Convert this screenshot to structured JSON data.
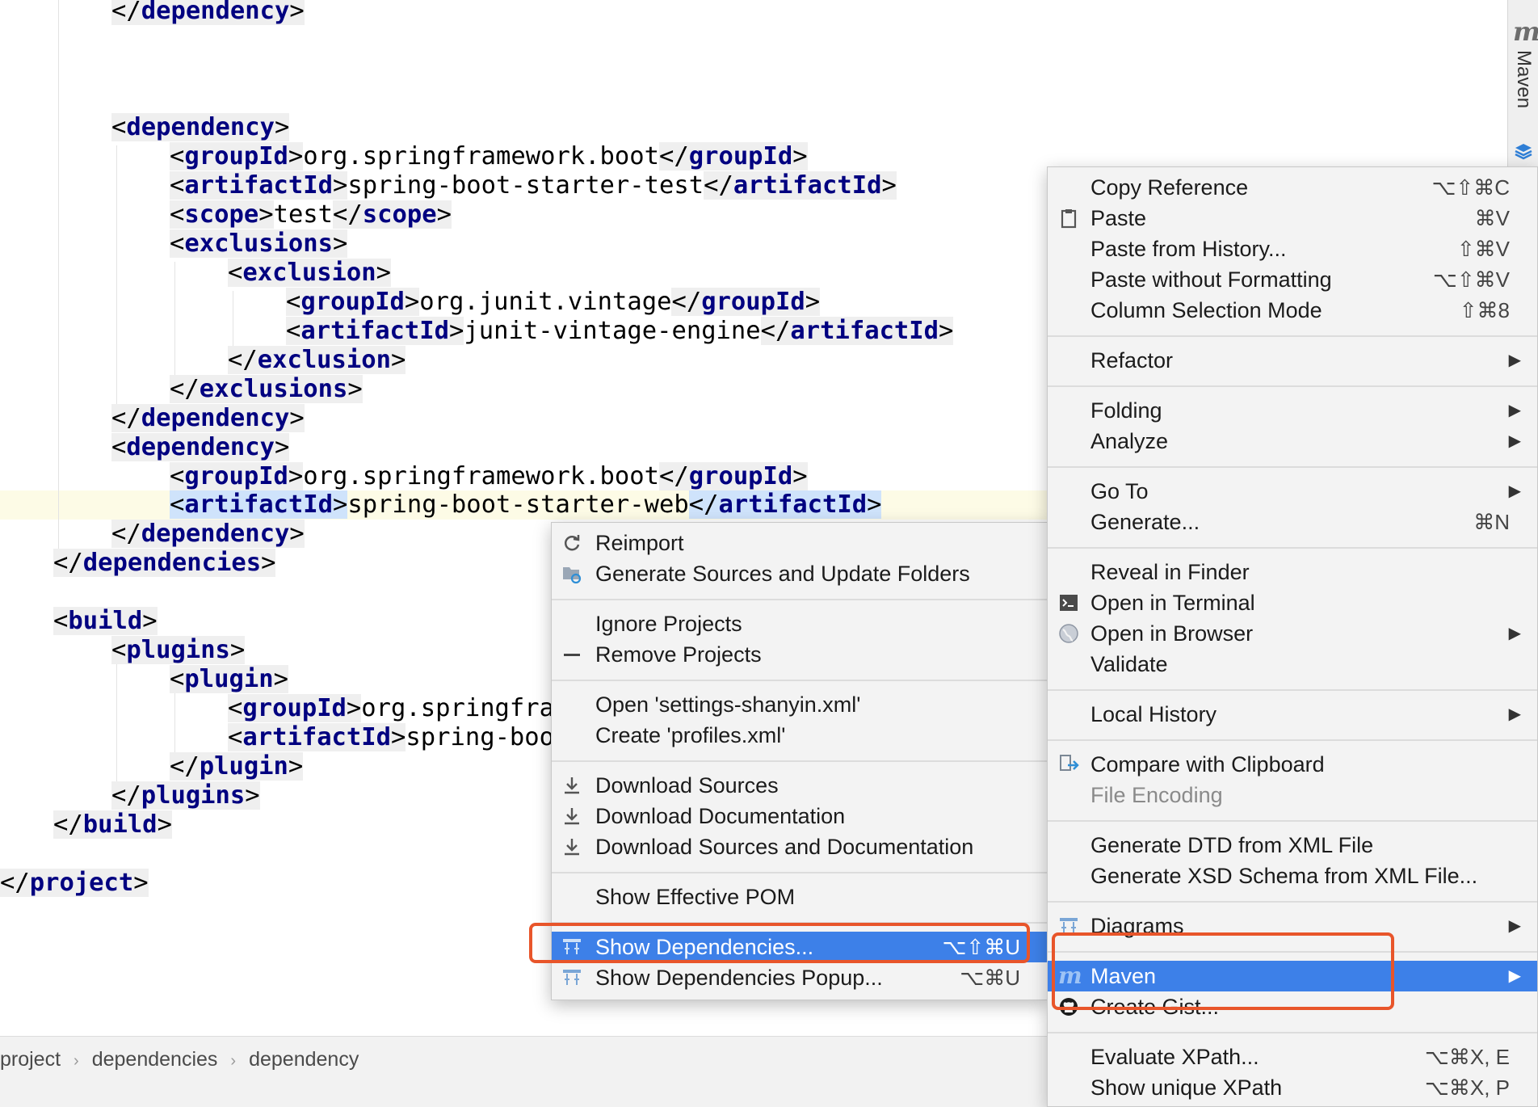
{
  "editor": {
    "lines": [
      [
        [
          "br",
          "</"
        ],
        [
          "tag",
          "dependency"
        ],
        [
          "br",
          ">"
        ]
      ],
      [
        [
          "br",
          "<"
        ],
        [
          "tag",
          "dependency"
        ],
        [
          "br",
          ">"
        ]
      ],
      [
        [
          "br",
          "<"
        ],
        [
          "tag",
          "groupId"
        ],
        [
          "br",
          ">"
        ],
        [
          "tx",
          "org.springframework.boot"
        ],
        [
          "br",
          "</"
        ],
        [
          "tag",
          "groupId"
        ],
        [
          "br",
          ">"
        ]
      ],
      [
        [
          "br",
          "<"
        ],
        [
          "tag",
          "artifactId"
        ],
        [
          "br",
          ">"
        ],
        [
          "tx",
          "spring-boot-starter-test"
        ],
        [
          "br",
          "</"
        ],
        [
          "tag",
          "artifactId"
        ],
        [
          "br",
          ">"
        ]
      ],
      [
        [
          "br",
          "<"
        ],
        [
          "tag",
          "scope"
        ],
        [
          "br",
          ">"
        ],
        [
          "tx",
          "test"
        ],
        [
          "br",
          "</"
        ],
        [
          "tag",
          "scope"
        ],
        [
          "br",
          ">"
        ]
      ],
      [
        [
          "br",
          "<"
        ],
        [
          "tag",
          "exclusions"
        ],
        [
          "br",
          ">"
        ]
      ],
      [
        [
          "br",
          "<"
        ],
        [
          "tag",
          "exclusion"
        ],
        [
          "br",
          ">"
        ]
      ],
      [
        [
          "br",
          "<"
        ],
        [
          "tag",
          "groupId"
        ],
        [
          "br",
          ">"
        ],
        [
          "tx",
          "org.junit.vintage"
        ],
        [
          "br",
          "</"
        ],
        [
          "tag",
          "groupId"
        ],
        [
          "br",
          ">"
        ]
      ],
      [
        [
          "br",
          "<"
        ],
        [
          "tag",
          "artifactId"
        ],
        [
          "br",
          ">"
        ],
        [
          "tx",
          "junit-vintage-engine"
        ],
        [
          "br",
          "</"
        ],
        [
          "tag",
          "artifactId"
        ],
        [
          "br",
          ">"
        ]
      ],
      [
        [
          "br",
          "</"
        ],
        [
          "tag",
          "exclusion"
        ],
        [
          "br",
          ">"
        ]
      ],
      [
        [
          "br",
          "</"
        ],
        [
          "tag",
          "exclusions"
        ],
        [
          "br",
          ">"
        ]
      ],
      [
        [
          "br",
          "</"
        ],
        [
          "tag",
          "dependency"
        ],
        [
          "br",
          ">"
        ]
      ],
      [
        [
          "br",
          "<"
        ],
        [
          "tag",
          "dependency"
        ],
        [
          "br",
          ">"
        ]
      ],
      [
        [
          "br",
          "<"
        ],
        [
          "tag",
          "groupId"
        ],
        [
          "br",
          ">"
        ],
        [
          "tx",
          "org.springframework.boot"
        ],
        [
          "br",
          "</"
        ],
        [
          "tag",
          "groupId"
        ],
        [
          "br",
          ">"
        ]
      ],
      [
        [
          "br",
          "<"
        ],
        [
          "tag",
          "artifactId"
        ],
        [
          "br",
          ">"
        ],
        [
          "tx",
          "spring-boot-starter-web"
        ],
        [
          "br",
          "</"
        ],
        [
          "tag",
          "artifactId"
        ],
        [
          "br",
          ">"
        ]
      ],
      [
        [
          "br",
          "</"
        ],
        [
          "tag",
          "dependency"
        ],
        [
          "br",
          ">"
        ]
      ],
      [
        [
          "br",
          "</"
        ],
        [
          "tag",
          "dependencies"
        ],
        [
          "br",
          ">"
        ]
      ],
      [
        [
          "br",
          "<"
        ],
        [
          "tag",
          "build"
        ],
        [
          "br",
          ">"
        ]
      ],
      [
        [
          "br",
          "<"
        ],
        [
          "tag",
          "plugins"
        ],
        [
          "br",
          ">"
        ]
      ],
      [
        [
          "br",
          "<"
        ],
        [
          "tag",
          "plugin"
        ],
        [
          "br",
          ">"
        ]
      ],
      [
        [
          "br",
          "<"
        ],
        [
          "tag",
          "groupId"
        ],
        [
          "br",
          ">"
        ],
        [
          "tx",
          "org.springfra"
        ]
      ],
      [
        [
          "br",
          "<"
        ],
        [
          "tag",
          "artifactId"
        ],
        [
          "br",
          ">"
        ],
        [
          "tx",
          "spring-boo"
        ]
      ],
      [
        [
          "br",
          "</"
        ],
        [
          "tag",
          "plugin"
        ],
        [
          "br",
          ">"
        ]
      ],
      [
        [
          "br",
          "</"
        ],
        [
          "tag",
          "plugins"
        ],
        [
          "br",
          ">"
        ]
      ],
      [
        [
          "br",
          "</"
        ],
        [
          "tag",
          "build"
        ],
        [
          "br",
          ">"
        ]
      ],
      [
        [
          "br",
          "</"
        ],
        [
          "tag",
          "project"
        ],
        [
          "br",
          ">"
        ]
      ]
    ]
  },
  "tool_window": {
    "label": "Maven",
    "logo": "m",
    "icons": [
      "maven-m-icon",
      "layers-icon"
    ]
  },
  "breadcrumb": [
    "project",
    "dependencies",
    "dependency"
  ],
  "submenu": {
    "items": [
      {
        "label": "Reimport",
        "icon": "refresh-icon"
      },
      {
        "label": "Generate Sources and Update Folders",
        "icon": "generate-folders-icon"
      },
      {
        "label": "Ignore Projects"
      },
      {
        "label": "Remove Projects",
        "icon": "minus-icon"
      },
      {
        "label": "Open 'settings-shanyin.xml'"
      },
      {
        "label": "Create 'profiles.xml'"
      },
      {
        "label": "Download Sources",
        "icon": "download-icon"
      },
      {
        "label": "Download Documentation",
        "icon": "download-icon"
      },
      {
        "label": "Download Sources and Documentation",
        "icon": "download-icon"
      },
      {
        "label": "Show Effective POM"
      },
      {
        "label": "Show Dependencies...",
        "shortcut": "⌥⇧⌘U",
        "icon": "dependencies-icon",
        "active": true
      },
      {
        "label": "Show Dependencies Popup...",
        "shortcut": "⌥⌘U",
        "icon": "dependencies-icon"
      }
    ]
  },
  "context_menu": {
    "items": [
      {
        "label": "Copy Reference",
        "shortcut": "⌥⇧⌘C"
      },
      {
        "label": "Paste",
        "shortcut": "⌘V",
        "icon": "clipboard-icon"
      },
      {
        "label": "Paste from History...",
        "shortcut": "⇧⌘V"
      },
      {
        "label": "Paste without Formatting",
        "shortcut": "⌥⇧⌘V"
      },
      {
        "label": "Column Selection Mode",
        "shortcut": "⇧⌘8"
      },
      {
        "label": "Refactor",
        "arrow": "▶"
      },
      {
        "label": "Folding",
        "arrow": "▶"
      },
      {
        "label": "Analyze",
        "arrow": "▶"
      },
      {
        "label": "Go To",
        "arrow": "▶"
      },
      {
        "label": "Generate...",
        "shortcut": "⌘N"
      },
      {
        "label": "Reveal in Finder"
      },
      {
        "label": "Open in Terminal",
        "icon": "terminal-icon"
      },
      {
        "label": "Open in Browser",
        "arrow": "▶",
        "icon": "globe-icon"
      },
      {
        "label": "Validate"
      },
      {
        "label": "Local History",
        "arrow": "▶"
      },
      {
        "label": "Compare with Clipboard",
        "icon": "compare-icon"
      },
      {
        "label": "File Encoding",
        "disabled": true
      },
      {
        "label": "Generate DTD from XML File"
      },
      {
        "label": "Generate XSD Schema from XML File..."
      },
      {
        "label": "Diagrams",
        "arrow": "▶",
        "icon": "diagram-icon"
      },
      {
        "label": "Maven",
        "arrow": "▶",
        "icon": "maven-m-icon",
        "active": true
      },
      {
        "label": "Create Gist...",
        "icon": "github-icon"
      },
      {
        "label": "Evaluate XPath...",
        "shortcut": "⌥⌘X, E"
      },
      {
        "label": "Show unique XPath",
        "shortcut": "⌥⌘X, P"
      }
    ]
  },
  "colors": {
    "tag": "#000080",
    "selection": "#3d80e8",
    "highlight_box": "#e8552a",
    "caret_line": "#fdfbe6"
  }
}
